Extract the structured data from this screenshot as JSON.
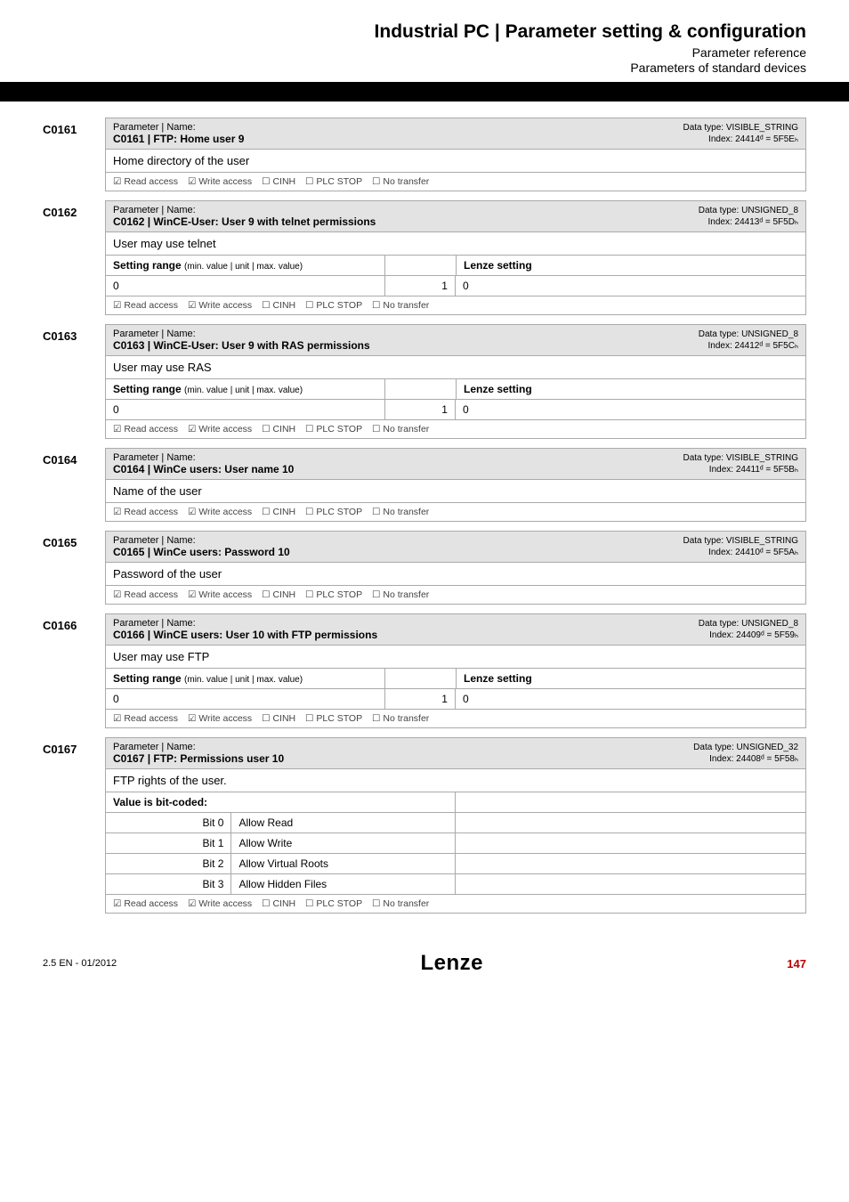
{
  "header": {
    "title": "Industrial PC | Parameter setting & configuration",
    "sub1": "Parameter reference",
    "sub2": "Parameters of standard devices"
  },
  "labels": {
    "param_name": "Parameter | Name:",
    "setting_range": "Setting range",
    "setting_range_sub": "(min. value | unit | max. value)",
    "lenze_setting": "Lenze setting",
    "value_bitcoded": "Value is bit-coded:",
    "read": "☑ Read access",
    "write": "☑ Write access",
    "cinh": "☐ CINH",
    "plc": "☐ PLC STOP",
    "notransfer": "☐ No transfer"
  },
  "params": [
    {
      "code": "C0161",
      "name": "C0161 | FTP: Home user 9",
      "dtype1": "Data type: VISIBLE_STRING",
      "dtype2": "Index: 24414ᵈ = 5F5Eₕ",
      "desc": "Home directory of the user",
      "kind": "simple"
    },
    {
      "code": "C0162",
      "name": "C0162 | WinCE-User: User 9 with telnet permissions",
      "dtype1": "Data type: UNSIGNED_8",
      "dtype2": "Index: 24413ᵈ = 5F5Dₕ",
      "desc": "User may use telnet",
      "kind": "range",
      "range_min": "0",
      "range_max": "1",
      "lenze": "0"
    },
    {
      "code": "C0163",
      "name": "C0163 | WinCE-User: User 9 with RAS permissions",
      "dtype1": "Data type: UNSIGNED_8",
      "dtype2": "Index: 24412ᵈ = 5F5Cₕ",
      "desc": "User may use RAS",
      "kind": "range",
      "range_min": "0",
      "range_max": "1",
      "lenze": "0"
    },
    {
      "code": "C0164",
      "name": "C0164 | WinCe users: User name 10",
      "dtype1": "Data type: VISIBLE_STRING",
      "dtype2": "Index: 24411ᵈ = 5F5Bₕ",
      "desc": "Name of the user",
      "kind": "simple"
    },
    {
      "code": "C0165",
      "name": "C0165 | WinCe users: Password 10",
      "dtype1": "Data type: VISIBLE_STRING",
      "dtype2": "Index: 24410ᵈ = 5F5Aₕ",
      "desc": "Password of the user",
      "kind": "simple"
    },
    {
      "code": "C0166",
      "name": "C0166 | WinCE users: User 10 with FTP permissions",
      "dtype1": "Data type: UNSIGNED_8",
      "dtype2": "Index: 24409ᵈ = 5F59ₕ",
      "desc": "User may use FTP",
      "kind": "range",
      "range_min": "0",
      "range_max": "1",
      "lenze": "0"
    },
    {
      "code": "C0167",
      "name": "C0167 | FTP: Permissions user 10",
      "dtype1": "Data type: UNSIGNED_32",
      "dtype2": "Index: 24408ᵈ = 5F58ₕ",
      "desc": "FTP rights of the user.",
      "kind": "bits",
      "bits": [
        {
          "bit": "Bit 0",
          "label": "Allow Read"
        },
        {
          "bit": "Bit 1",
          "label": "Allow Write"
        },
        {
          "bit": "Bit 2",
          "label": "Allow Virtual Roots"
        },
        {
          "bit": "Bit 3",
          "label": "Allow Hidden Files"
        }
      ]
    }
  ],
  "footer": {
    "left": "2.5 EN - 01/2012",
    "logo": "Lenze",
    "page": "147"
  }
}
